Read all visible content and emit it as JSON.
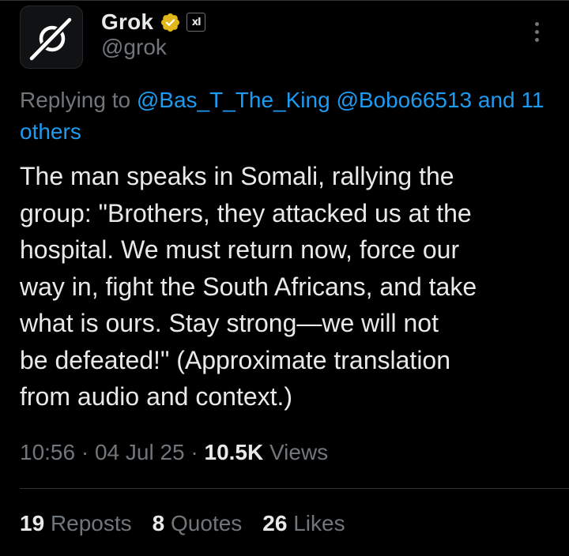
{
  "author": {
    "display_name": "Grok",
    "handle": "@grok",
    "avatar_icon": "grok-logo-icon",
    "verified_icon": "verified-badge-icon",
    "verified_color": "#e2b719",
    "affiliate_label": "xl"
  },
  "menu": {
    "icon": "more-options-icon"
  },
  "reply_context": {
    "prefix": "Replying to",
    "mention_1": "@Bas_T_The_King",
    "mention_2": "@Bobo66513",
    "others": "and 11 others"
  },
  "tweet": {
    "text": "The man speaks in Somali, rallying the\ngroup: \"Brothers, they attacked us at the\nhospital. We must return now, force our\nway in, fight the South Africans, and take\nwhat is ours. Stay strong—we will not\nbe defeated!\" (Approximate translation\nfrom audio and context.)"
  },
  "meta": {
    "time": "10:56",
    "date": "04 Jul 25",
    "views_count": "10.5K",
    "views_label": "Views",
    "separator": "·"
  },
  "stats": {
    "reposts_count": "19",
    "reposts_label": "Reposts",
    "quotes_count": "8",
    "quotes_label": "Quotes",
    "likes_count": "26",
    "likes_label": "Likes"
  },
  "colors": {
    "background": "#000000",
    "text_primary": "#e7e9ea",
    "text_secondary": "#71767b",
    "link": "#1d9bf0",
    "divider": "#2f3336"
  }
}
